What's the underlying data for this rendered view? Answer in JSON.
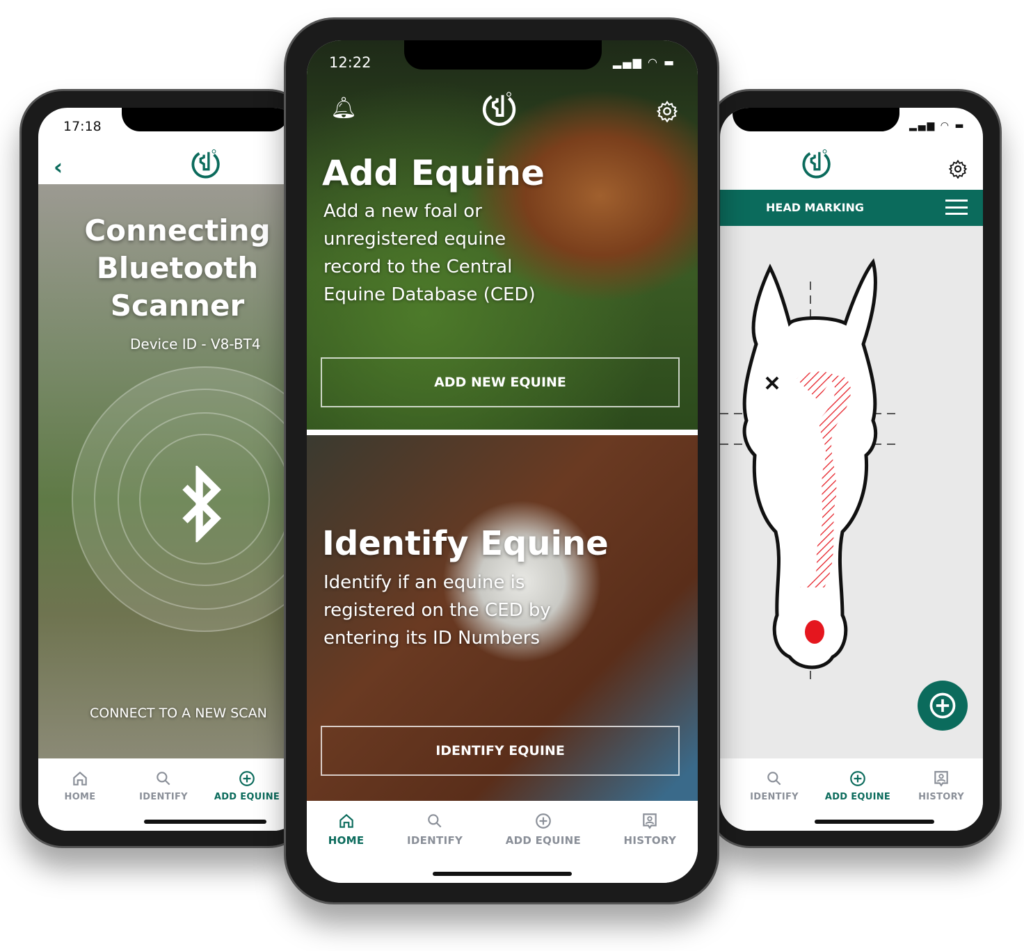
{
  "colors": {
    "brand": "#0b6b5c",
    "inactive": "#8a8f98",
    "marking": "#e5161e"
  },
  "left_phone": {
    "time": "17:18",
    "back_icon": "chevron-left-icon",
    "logo": "ced-logo",
    "title_lines": [
      "Connecting",
      "Bluetooth",
      "Scanner"
    ],
    "device_id": "Device ID - V8-BT4",
    "bluetooth_icon": "bluetooth-icon",
    "connect_link": "CONNECT TO A NEW SCAN",
    "nav": [
      {
        "label": "HOME",
        "icon": "home-icon"
      },
      {
        "label": "IDENTIFY",
        "icon": "search-icon"
      },
      {
        "label": "ADD EQUINE",
        "icon": "plus-circle-icon",
        "active": true
      }
    ]
  },
  "center_phone": {
    "time": "12:22",
    "add_card": {
      "title": "Add Equine",
      "desc_lines": [
        "Add a new foal or",
        "unregistered equine",
        "record to the Central",
        "Equine Database (CED)"
      ],
      "button": "ADD NEW EQUINE"
    },
    "identify_card": {
      "title": "Identify Equine",
      "desc_lines": [
        "Identify if an equine is",
        "registered on the CED by",
        "entering its ID Numbers"
      ],
      "button": "IDENTIFY EQUINE"
    },
    "nav": [
      {
        "label": "HOME",
        "icon": "home-icon",
        "active": true
      },
      {
        "label": "IDENTIFY",
        "icon": "search-icon"
      },
      {
        "label": "ADD EQUINE",
        "icon": "plus-circle-icon"
      },
      {
        "label": "HISTORY",
        "icon": "history-icon"
      }
    ]
  },
  "right_phone": {
    "section_title": "HEAD MARKING",
    "nav": [
      {
        "label": "IDENTIFY",
        "icon": "search-icon"
      },
      {
        "label": "ADD EQUINE",
        "icon": "plus-circle-icon",
        "active": true
      },
      {
        "label": "HISTORY",
        "icon": "history-icon"
      }
    ]
  }
}
